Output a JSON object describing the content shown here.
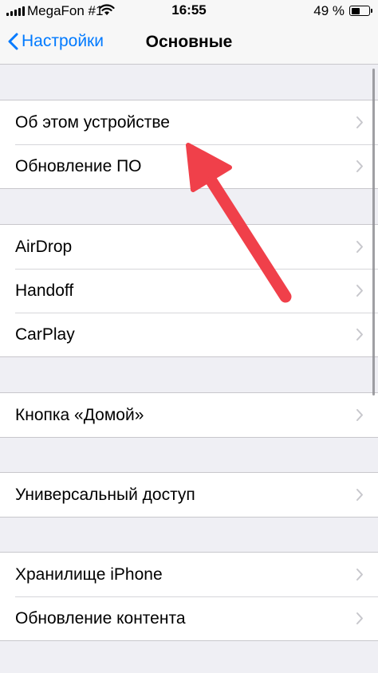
{
  "status_bar": {
    "carrier": "MegaFon #1",
    "time": "16:55",
    "battery_percent": "49 %",
    "battery_level": 0.49
  },
  "nav": {
    "back_label": "Настройки",
    "title": "Основные"
  },
  "groups": [
    {
      "items": [
        {
          "label": "Об этом устройстве"
        },
        {
          "label": "Обновление ПО"
        }
      ]
    },
    {
      "items": [
        {
          "label": "AirDrop"
        },
        {
          "label": "Handoff"
        },
        {
          "label": "CarPlay"
        }
      ]
    },
    {
      "items": [
        {
          "label": "Кнопка «Домой»"
        }
      ]
    },
    {
      "items": [
        {
          "label": "Универсальный доступ"
        }
      ]
    },
    {
      "items": [
        {
          "label": "Хранилище iPhone"
        },
        {
          "label": "Обновление контента"
        }
      ]
    }
  ],
  "colors": {
    "accent": "#007aff",
    "background": "#efeff4",
    "annotation_arrow": "#f0404a"
  }
}
